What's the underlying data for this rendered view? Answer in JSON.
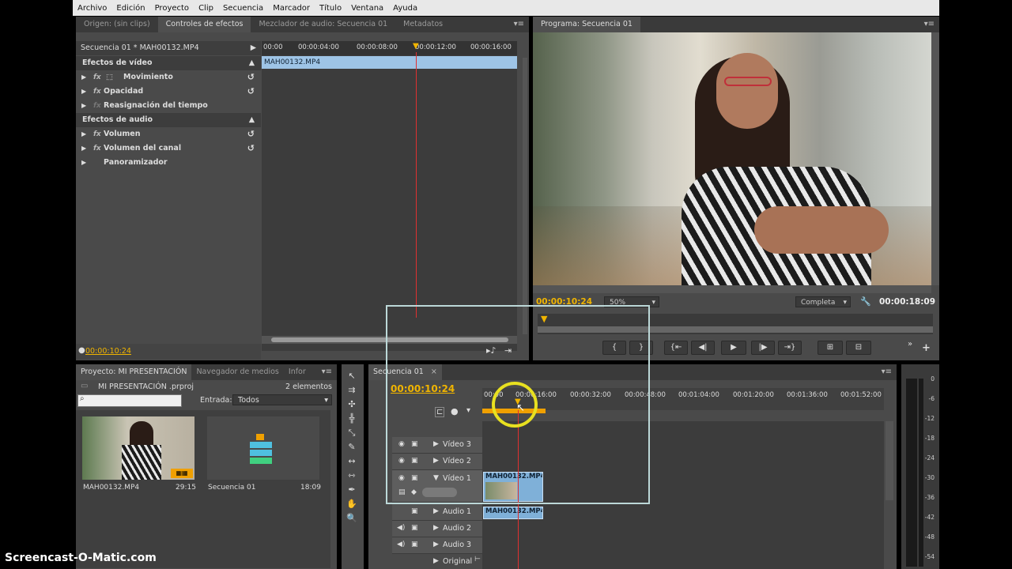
{
  "menu": [
    "Archivo",
    "Edición",
    "Proyecto",
    "Clip",
    "Secuencia",
    "Marcador",
    "Título",
    "Ventana",
    "Ayuda"
  ],
  "effects_panel": {
    "tabs": [
      "Origen: (sin clips)",
      "Controles de efectos",
      "Mezclador de audio: Secuencia 01",
      "Metadatos"
    ],
    "clip_header": "Secuencia 01 * MAH00132.MP4",
    "ruler": [
      "00:00",
      "00:00:04:00",
      "00:00:08:00",
      "00:00:12:00",
      "00:00:16:00"
    ],
    "clip_bar": "MAH00132.MP4",
    "video_section": "Efectos de vídeo",
    "video_effects": [
      "Movimiento",
      "Opacidad",
      "Reasignación del tiempo"
    ],
    "audio_section": "Efectos de audio",
    "audio_effects": [
      "Volumen",
      "Volumen del canal",
      "Panoramizador"
    ],
    "timecode": "00:00:10:24"
  },
  "program_monitor": {
    "tab": "Programa: Secuencia 01",
    "timecode": "00:00:10:24",
    "zoom": "50%",
    "resolution": "Completa",
    "duration": "00:00:18:09"
  },
  "project_panel": {
    "tabs": [
      "Proyecto: MI PRESENTACIÓN",
      "Navegador de medios",
      "Infor"
    ],
    "project_file": "MI PRESENTACIÓN .prproj",
    "item_count": "2 elementos",
    "entrada_label": "Entrada:",
    "entrada_value": "Todos",
    "items": [
      {
        "name": "MAH00132.MP4",
        "duration": "29:15"
      },
      {
        "name": "Secuencia 01",
        "duration": "18:09"
      }
    ]
  },
  "timeline": {
    "tab": "Secuencia 01",
    "timecode": "00:00:10:24",
    "ruler": [
      "00:00",
      "00:00:16:00",
      "00:00:32:00",
      "00:00:48:00",
      "00:01:04:00",
      "00:01:20:00",
      "00:01:36:00",
      "00:01:52:00"
    ],
    "tracks": {
      "video3": "Vídeo 3",
      "video2": "Vídeo 2",
      "video1": "Vídeo 1",
      "audio1": "Audio 1",
      "audio2": "Audio 2",
      "audio3": "Audio 3",
      "master": "Original"
    },
    "video_clip": "MAH00132.MP4 [",
    "audio_clip": "MAH00132.MP4 ["
  },
  "vu_meter": [
    "0",
    "-6",
    "-12",
    "-18",
    "-24",
    "-30",
    "-36",
    "-42",
    "-48",
    "-54"
  ],
  "watermark": "Screencast-O-Matic.com",
  "colors": {
    "accent_timecode": "#f0b400",
    "clip_blue": "#7fb0d8",
    "playhead": "#e03030"
  }
}
